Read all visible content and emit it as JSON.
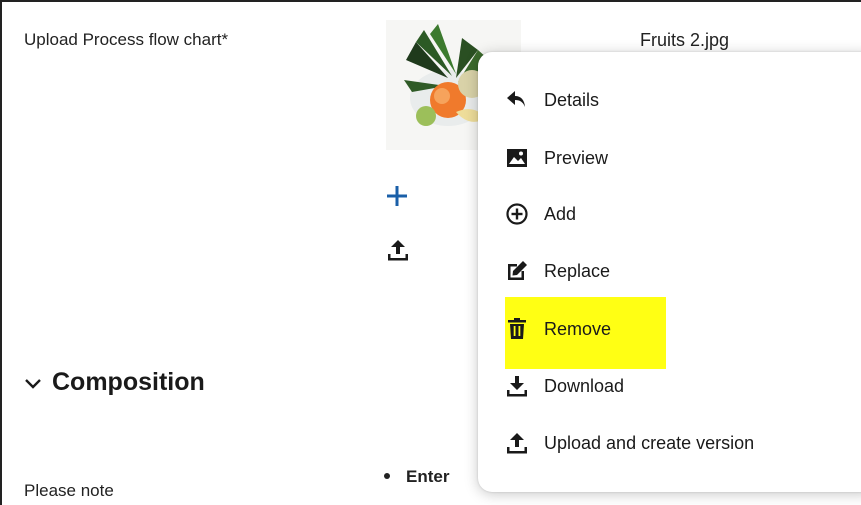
{
  "form": {
    "upload_label": "Upload Process flow chart*",
    "file_name": "Fruits 2.jpg",
    "section_title": "Composition",
    "please_note": "Please note",
    "bullet_text": "Enter"
  },
  "icons": {
    "thumbnail": "fruit-thumbnail-image",
    "add": "plus-icon",
    "upload": "upload-icon",
    "section_toggle": "chevron-down-icon"
  },
  "context_menu": {
    "items": [
      {
        "label": "Details",
        "icon": "back-arrow-icon"
      },
      {
        "label": "Preview",
        "icon": "image-preview-icon"
      },
      {
        "label": "Add",
        "icon": "circle-plus-icon"
      },
      {
        "label": "Replace",
        "icon": "edit-icon"
      },
      {
        "label": "Remove",
        "icon": "trash-icon",
        "highlighted": true
      },
      {
        "label": "Download",
        "icon": "download-icon"
      },
      {
        "label": "Upload and create version",
        "icon": "upload-icon"
      }
    ]
  },
  "colors": {
    "highlight": "#ffff14",
    "accent_plus": "#1a5fa8",
    "text": "#1a1a1a"
  }
}
